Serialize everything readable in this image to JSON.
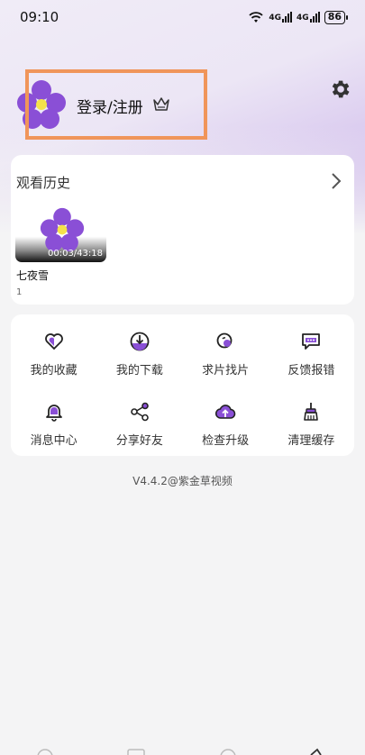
{
  "status": {
    "time": "09:10",
    "signal1": "4G",
    "signal2": "4G",
    "battery": "86"
  },
  "profile": {
    "login_label": "登录/注册"
  },
  "history": {
    "title": "观看历史",
    "items": [
      {
        "title": "七夜雪",
        "duration": "00:03/43:18",
        "episode": "1"
      }
    ]
  },
  "menu": {
    "items": [
      {
        "label": "我的收藏",
        "icon": "heart-icon"
      },
      {
        "label": "我的下载",
        "icon": "download-icon"
      },
      {
        "label": "求片找片",
        "icon": "request-icon"
      },
      {
        "label": "反馈报错",
        "icon": "feedback-icon"
      },
      {
        "label": "消息中心",
        "icon": "bell-icon"
      },
      {
        "label": "分享好友",
        "icon": "share-icon"
      },
      {
        "label": "检查升级",
        "icon": "cloud-upload-icon"
      },
      {
        "label": "清理缓存",
        "icon": "broom-icon"
      }
    ]
  },
  "footer": {
    "version": "V4.4.2@紫金草视频"
  },
  "colors": {
    "accent": "#8a4fd6",
    "highlight_box": "#f0955a"
  }
}
